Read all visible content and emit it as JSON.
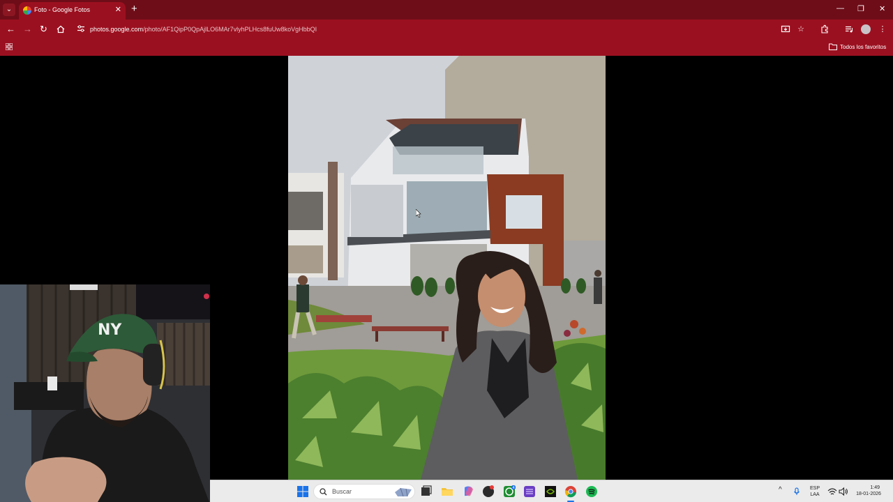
{
  "browser": {
    "tab_title": "Foto - Google Fotos",
    "url_host": "photos.google.com",
    "url_path": "/photo/AF1QipP0QpAjlLO6MAr7vlyhPLHcs8fuUw8koVgHbbQI",
    "bookmarks_folder": "Todos los favoritos",
    "theme_color": "#9b1020"
  },
  "taskbar": {
    "search_placeholder": "Buscar",
    "language": "ESP",
    "layout": "LAA",
    "time": "1:49",
    "date": "18-01-2026"
  }
}
